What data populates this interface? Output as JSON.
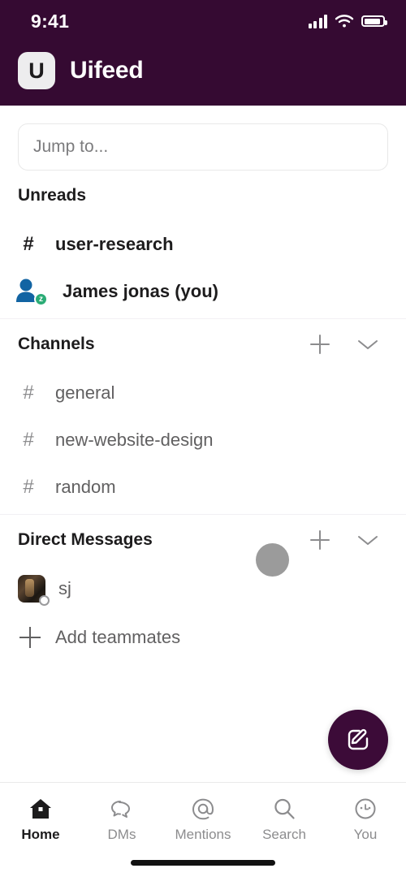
{
  "status_bar": {
    "time": "9:41",
    "signal_icon": "signal-bars-icon",
    "wifi_icon": "wifi-icon",
    "battery_icon": "battery-icon"
  },
  "header": {
    "logo_letter": "U",
    "workspace_name": "Uifeed",
    "background_color": "#350A32"
  },
  "search": {
    "placeholder": "Jump to...",
    "value": ""
  },
  "sections": {
    "unreads": {
      "title": "Unreads",
      "items": [
        {
          "type": "channel",
          "icon": "hash-icon",
          "label": "user-research",
          "unread": true
        },
        {
          "type": "person",
          "icon": "person-icon",
          "label": "James jonas (you)",
          "unread": true,
          "status": "away",
          "status_letter": "z",
          "status_color": "#2BAC76",
          "avatar_color": "#1264A3"
        }
      ]
    },
    "channels": {
      "title": "Channels",
      "add_icon": "plus-icon",
      "collapse_icon": "chevron-down-icon",
      "items": [
        {
          "icon": "hash-icon",
          "label": "general"
        },
        {
          "icon": "hash-icon",
          "label": "new-website-design"
        },
        {
          "icon": "hash-icon",
          "label": "random"
        }
      ]
    },
    "direct_messages": {
      "title": "Direct Messages",
      "add_icon": "plus-icon",
      "collapse_icon": "chevron-down-icon",
      "items": [
        {
          "icon": "avatar-photo",
          "label": "sj",
          "presence": "offline"
        }
      ],
      "add_teammates_label": "Add teammates",
      "add_teammates_icon": "plus-icon"
    }
  },
  "compose_button": {
    "icon": "compose-icon",
    "color": "#3C0B38"
  },
  "touch_indicator": {
    "visible": true,
    "color": "#9B9B9B"
  },
  "tab_bar": {
    "tabs": [
      {
        "icon": "home-icon",
        "label": "Home",
        "active": true
      },
      {
        "icon": "dms-icon",
        "label": "DMs",
        "active": false
      },
      {
        "icon": "mentions-icon",
        "label": "Mentions",
        "active": false
      },
      {
        "icon": "search-icon",
        "label": "Search",
        "active": false
      },
      {
        "icon": "you-icon",
        "label": "You",
        "active": false
      }
    ]
  }
}
